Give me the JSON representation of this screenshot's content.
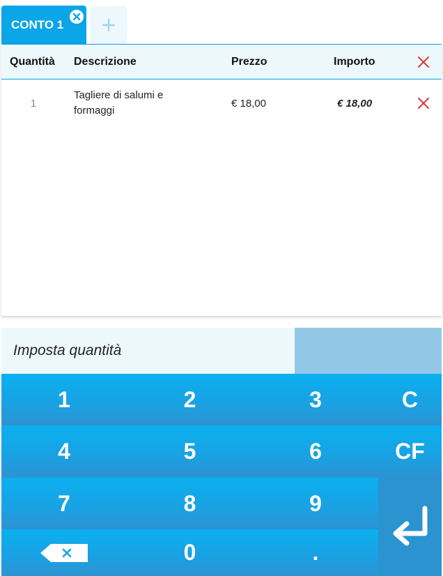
{
  "tabs": {
    "active_label": "CONTO 1",
    "close_icon": "close-circle-icon",
    "add_icon": "plus-icon"
  },
  "table": {
    "headers": {
      "quantity": "Quantità",
      "description": "Descrizione",
      "price": "Prezzo",
      "amount": "Importo"
    },
    "rows": [
      {
        "quantity": "1",
        "description": "Tagliere di salumi e formaggi",
        "price": "€ 18,00",
        "amount": "€ 18,00"
      }
    ]
  },
  "quantity_bar": {
    "label": "Imposta quantità",
    "value": ""
  },
  "keypad": {
    "k1": "1",
    "k2": "2",
    "k3": "3",
    "k4": "4",
    "k5": "5",
    "k6": "6",
    "k7": "7",
    "k8": "8",
    "k9": "9",
    "k0": "0",
    "kdot": ".",
    "clear": "C",
    "clear_full": "CF",
    "backspace_icon": "backspace-icon",
    "enter_icon": "enter-return-icon"
  },
  "colors": {
    "accent": "#0aa6e8",
    "delete_red": "#d93a3a",
    "header_bg": "#edf8fd",
    "display_bg": "#92c8e6"
  }
}
